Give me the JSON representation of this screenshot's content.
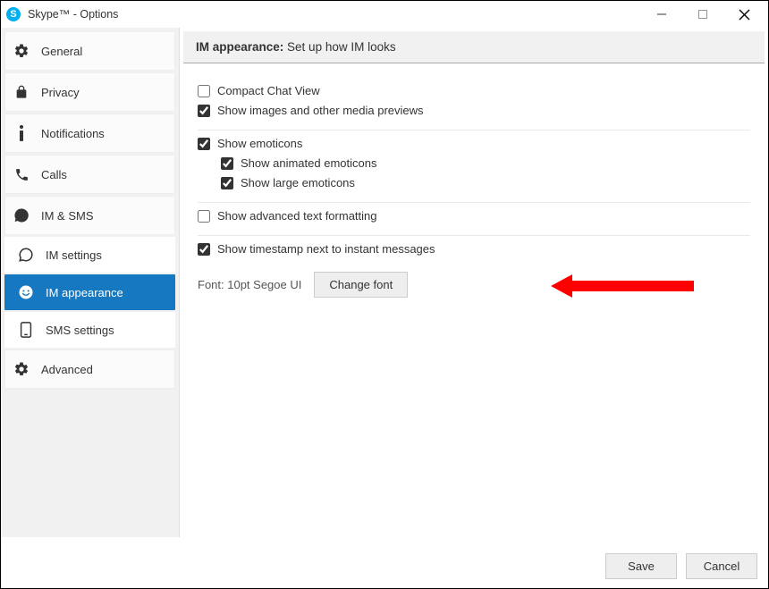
{
  "window": {
    "title": "Skype™ - Options"
  },
  "sidebar": {
    "items": [
      {
        "label": "General",
        "icon": "gear"
      },
      {
        "label": "Privacy",
        "icon": "lock"
      },
      {
        "label": "Notifications",
        "icon": "info"
      },
      {
        "label": "Calls",
        "icon": "phone"
      },
      {
        "label": "IM & SMS",
        "icon": "chat"
      },
      {
        "label": "IM settings",
        "icon": "chat-outline"
      },
      {
        "label": "IM appearance",
        "icon": "smiley"
      },
      {
        "label": "SMS settings",
        "icon": "device"
      },
      {
        "label": "Advanced",
        "icon": "gear"
      }
    ]
  },
  "main": {
    "header_bold": "IM appearance:",
    "header_rest": " Set up how IM looks",
    "options": {
      "compact_chat": {
        "label": "Compact Chat View",
        "checked": false
      },
      "media_previews": {
        "label": "Show images and other media previews",
        "checked": true
      },
      "show_emoticons": {
        "label": "Show emoticons",
        "checked": true
      },
      "show_animated": {
        "label": "Show animated emoticons",
        "checked": true
      },
      "show_large": {
        "label": "Show large emoticons",
        "checked": true
      },
      "advanced_formatting": {
        "label": "Show advanced text formatting",
        "checked": false
      },
      "timestamp": {
        "label": "Show timestamp next to instant messages",
        "checked": true
      }
    },
    "font_label": "Font: 10pt Segoe UI",
    "change_font_button": "Change font"
  },
  "footer": {
    "save": "Save",
    "cancel": "Cancel"
  }
}
